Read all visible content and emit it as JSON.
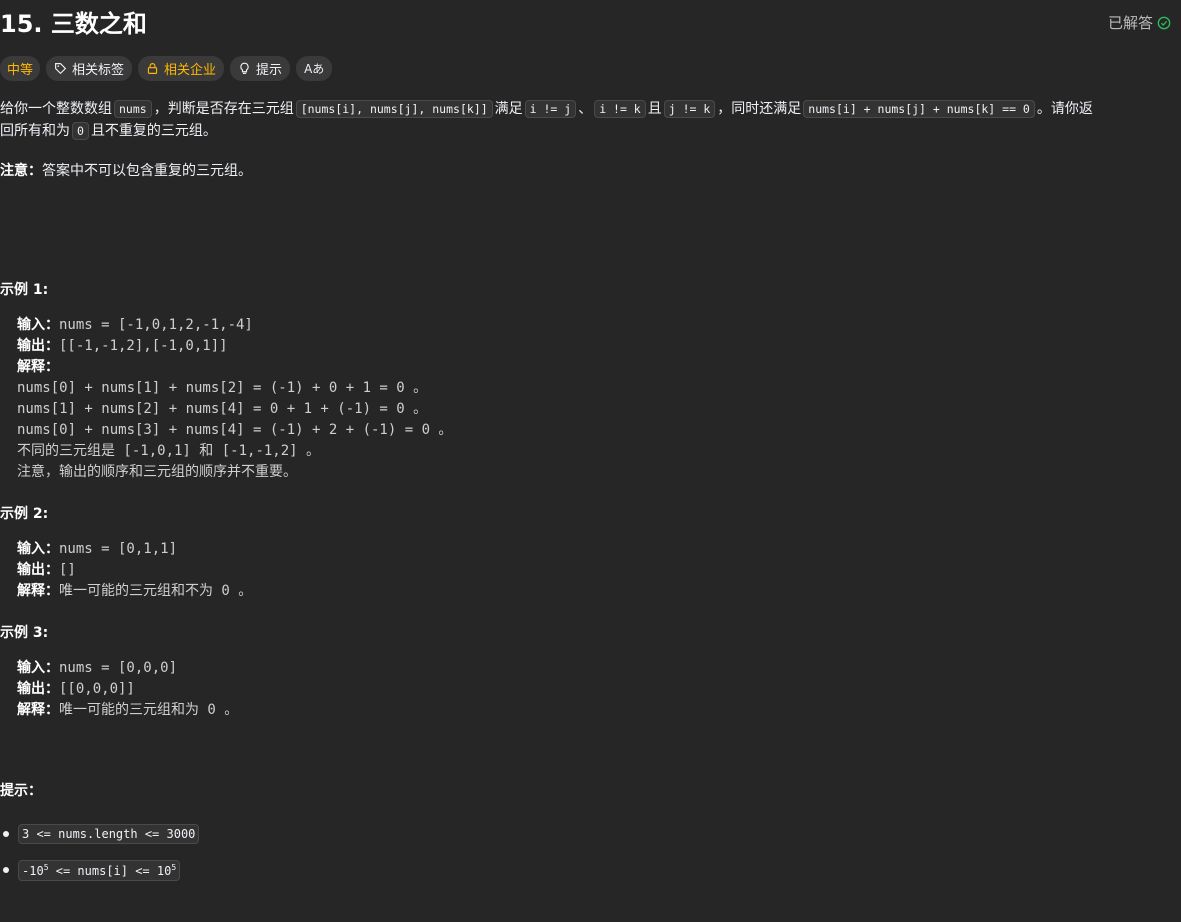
{
  "problem": {
    "title": "15. 三数之和",
    "solved_label": "已解答",
    "colors": {
      "accent_success": "#2cbb5d",
      "difficulty": "#ffb800"
    }
  },
  "tags": {
    "difficulty": "中等",
    "related_tags": "相关标签",
    "related_companies": "相关企业",
    "hint": "提示",
    "translate": "Aあ"
  },
  "description": {
    "p1_a": "给你一个整数数组",
    "p1_code1": "nums",
    "p1_b": "，判断是否存在三元组",
    "p1_code2": "[nums[i], nums[j], nums[k]]",
    "p1_c": "满足",
    "p1_code3": "i != j",
    "p1_d": "、",
    "p1_code4": "i != k",
    "p1_e": "且",
    "p1_code5": "j != k",
    "p1_f": "，同时还满足",
    "p1_code6": "nums[i] + nums[j] + nums[k] == 0",
    "p1_g": "。请你返",
    "p2_a": "回所有和为",
    "p2_code": "0",
    "p2_b": "且不重复的三元组。",
    "note_label": "注意：",
    "note_text": "答案中不可以包含重复的三元组。"
  },
  "examples": [
    {
      "heading": "示例 1:",
      "input_label": "输入：",
      "input": "nums = [-1,0,1,2,-1,-4]",
      "output_label": "输出：",
      "output": "[[-1,-1,2],[-1,0,1]]",
      "explain_label": "解释：",
      "explain_lines": [
        "nums[0] + nums[1] + nums[2] = (-1) + 0 + 1 = 0 。",
        "nums[1] + nums[2] + nums[4] = 0 + 1 + (-1) = 0 。",
        "nums[0] + nums[3] + nums[4] = (-1) + 2 + (-1) = 0 。"
      ],
      "extra_a_cn": "不同的三元组是",
      "extra_a_code": " [-1,0,1] ",
      "extra_a_and": "和",
      "extra_a_code2": " [-1,-1,2] ",
      "extra_a_end": "。",
      "extra_b": "注意，输出的顺序和三元组的顺序并不重要。"
    },
    {
      "heading": "示例 2:",
      "input_label": "输入：",
      "input": "nums = [0,1,1]",
      "output_label": "输出：",
      "output": "[]",
      "explain_label": "解释：",
      "explain_cn": "唯一可能的三元组和不为",
      "explain_code": " 0 ",
      "explain_end": "。"
    },
    {
      "heading": "示例 3:",
      "input_label": "输入：",
      "input": "nums = [0,0,0]",
      "output_label": "输出：",
      "output": "[[0,0,0]]",
      "explain_label": "解释：",
      "explain_cn": "唯一可能的三元组和为",
      "explain_code": " 0 ",
      "explain_end": "。"
    }
  ],
  "constraints": {
    "heading": "提示：",
    "c1": "3 <= nums.length <= 3000",
    "c2_a": "-10",
    "c2_sup1": "5",
    "c2_b": " <= nums[i] <= 10",
    "c2_sup2": "5"
  }
}
